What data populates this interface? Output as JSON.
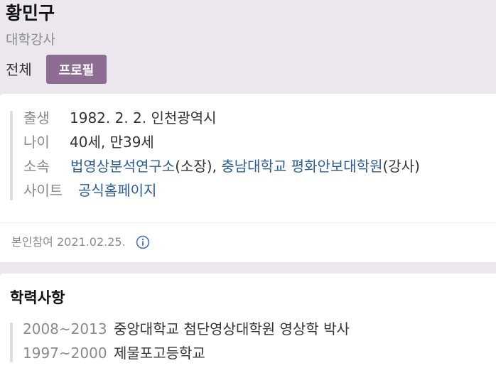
{
  "profile": {
    "name": "황민구",
    "job": "대학강사"
  },
  "tabs": {
    "all": "전체",
    "profile": "프로필"
  },
  "info": {
    "birth": {
      "label": "출생",
      "value": "1982. 2. 2. 인천광역시"
    },
    "age": {
      "label": "나이",
      "value": "40세, 만39세"
    },
    "affiliation": {
      "label": "소속",
      "link1": "법영상분석연구소",
      "text1": "(소장), ",
      "link2": "충남대학교 평화안보대학원",
      "text2": "(강사)"
    },
    "site": {
      "label": "사이트",
      "value": "공식홈페이지"
    }
  },
  "verification": "본인참여 2021.02.25.",
  "education": {
    "title": "학력사항",
    "items": [
      {
        "period": "2008~2013",
        "desc": "중앙대학교 첨단영상대학원 영상학 박사"
      },
      {
        "period": "1997~2000",
        "desc": "제물포고등학교"
      }
    ]
  },
  "colors": {
    "header_bg": "#ece6ee",
    "active_tab": "#8e6d92",
    "link": "#2a5c9a",
    "info_icon": "#4a73b5"
  }
}
